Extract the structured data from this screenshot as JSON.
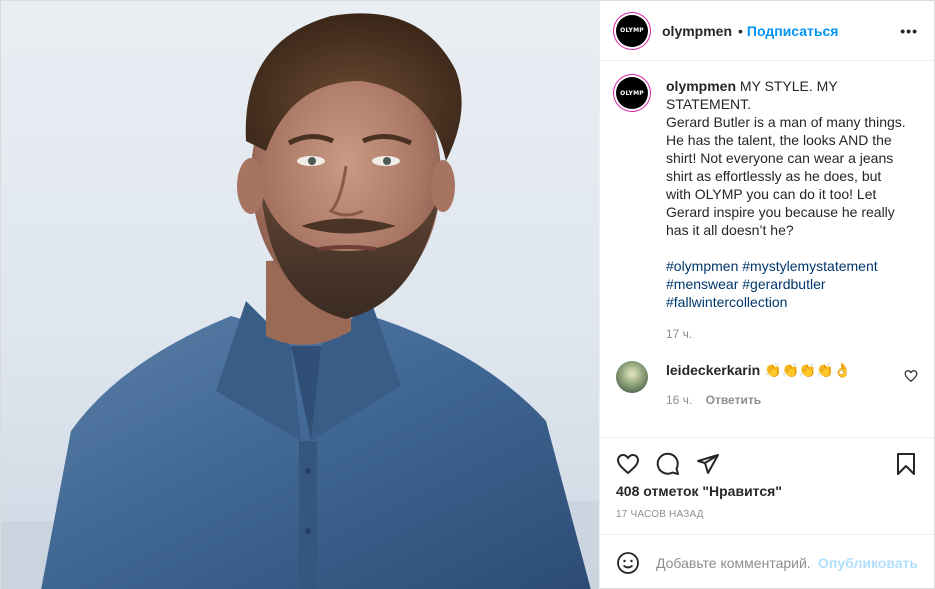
{
  "photo": {
    "subject": "man-in-denim-shirt-photo"
  },
  "header": {
    "username": "olympmen",
    "separator": "•",
    "follow_label": "Подписаться",
    "more_label": "•••",
    "avatar_text": "OLYMP"
  },
  "caption": {
    "username": "olympmen",
    "lines": [
      "MY STYLE. MY",
      "STATEMENT.",
      "Gerard Butler is a man of many things.",
      "He has the talent, the looks AND the",
      "shirt! Not everyone can wear a jeans",
      "shirt as effortlessly as he does, but",
      "with OLYMP you can do it too! Let",
      "Gerard inspire you because he really",
      "has it all doesn’t he?"
    ],
    "tags": [
      [
        "#olympmen",
        "#mystylemystatement"
      ],
      [
        "#menswear",
        "#gerardbutler"
      ],
      [
        "#fallwintercollection"
      ]
    ],
    "time": "17 ч."
  },
  "reply": {
    "username": "leideckerkarin",
    "text": "👏👏👏👏👌",
    "time": "16 ч.",
    "reply_label": "Ответить"
  },
  "likes_text": "408 отметок \"Нравится\"",
  "posted_time": "17 часов назад",
  "add_comment": {
    "placeholder": "Добавьте комментарий...",
    "publish_label": "Опубликовать"
  },
  "colors": {
    "accent": "#0095f6",
    "hashtag": "#00376b",
    "muted": "#8e8e8e",
    "publish_disabled": "#b2dffc"
  }
}
